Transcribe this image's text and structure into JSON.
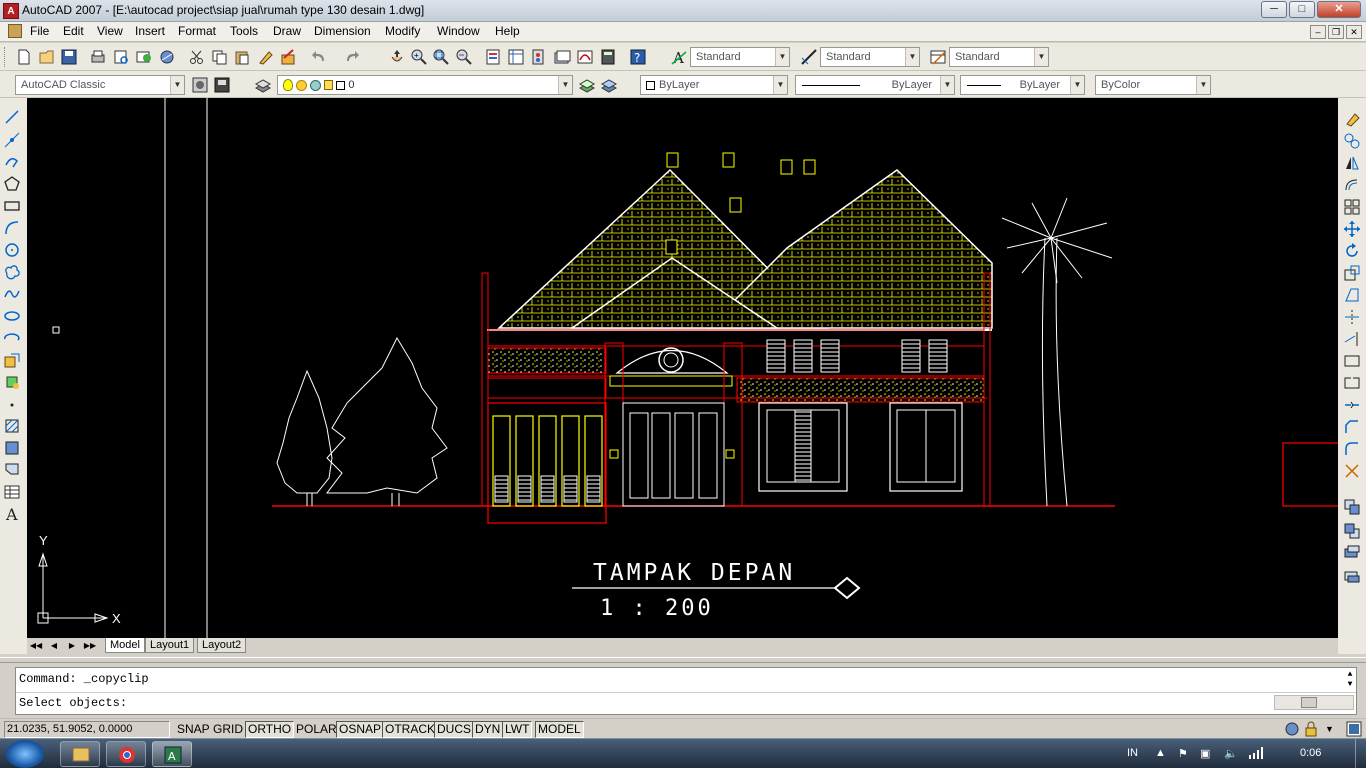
{
  "window": {
    "title": "AutoCAD 2007 - [E:\\autocad project\\siap jual\\rumah type 130 desain 1.dwg]",
    "app_icon": "autocad-logo-icon",
    "controls": [
      "minimize",
      "maximize",
      "close"
    ]
  },
  "menu": {
    "items": [
      "File",
      "Edit",
      "View",
      "Insert",
      "Format",
      "Tools",
      "Draw",
      "Dimension",
      "Modify",
      "Window",
      "Help"
    ]
  },
  "styles_toolbar": {
    "text_style": "Standard",
    "dim_style": "Standard",
    "table_style": "Standard"
  },
  "workspace": {
    "name": "AutoCAD Classic"
  },
  "layers": {
    "current_layer": "0"
  },
  "properties": {
    "color": "ByLayer",
    "linetype": "ByLayer",
    "lineweight": "ByLayer",
    "plotstyle": "ByColor"
  },
  "drawing": {
    "title": "TAMPAK DEPAN",
    "scale": "1 : 200",
    "ucs_x": "X",
    "ucs_y": "Y",
    "colors": {
      "background": "#000000",
      "lines": "#ffffff",
      "roof": "#ffff00",
      "frame": "#ff0000"
    }
  },
  "tabs": {
    "items": [
      "Model",
      "Layout1",
      "Layout2"
    ],
    "active": "Model"
  },
  "command": {
    "line1": "Command: _copyclip",
    "line2": "Select objects:"
  },
  "status": {
    "coords": "21.0235, 51.9052, 0.0000",
    "buttons": [
      "SNAP",
      "GRID",
      "ORTHO",
      "POLAR",
      "OSNAP",
      "OTRACK",
      "DUCS",
      "DYN",
      "LWT",
      "MODEL"
    ]
  },
  "taskbar": {
    "language": "IN",
    "time": "0:06"
  }
}
